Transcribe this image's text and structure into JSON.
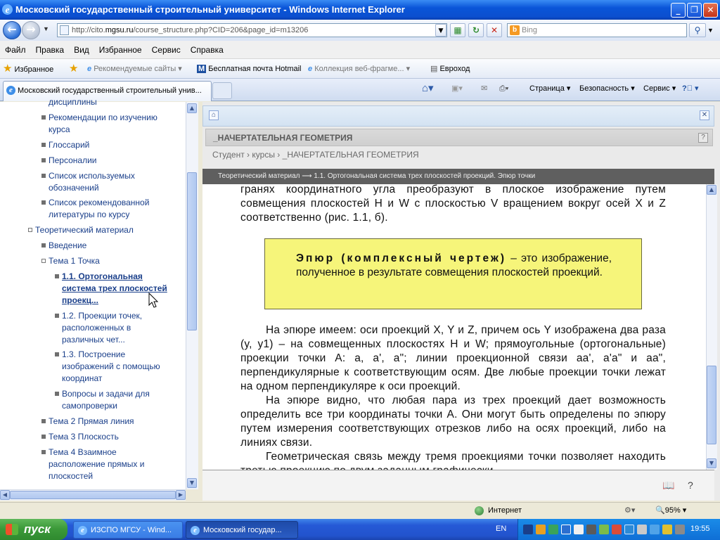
{
  "window": {
    "title": "Московский государственный строительный университет - Windows Internet Explorer"
  },
  "address": {
    "url_prefix": "http://cito.",
    "url_domain": "mgsu.ru",
    "url_rest": "/course_structure.php?CID=206&page_id=m13206",
    "search_placeholder": "Bing",
    "search_brand": "b"
  },
  "menu": [
    "Файл",
    "Правка",
    "Вид",
    "Избранное",
    "Сервис",
    "Справка"
  ],
  "favorites": {
    "favorites_label": "Избранное",
    "items": [
      "Рекомендуемые сайты",
      "Бесплатная почта Hotmail",
      "Коллекция веб-фрагме...",
      "Евроход"
    ]
  },
  "tabs": {
    "active": "Московский государственный строительный унив..."
  },
  "commandbar": {
    "page": "Страница",
    "safety": "Безопасность",
    "tools": "Сервис"
  },
  "sidebar": {
    "items": [
      {
        "label": "дисциплины"
      },
      {
        "label": "Рекомендации по изучению курса"
      },
      {
        "label": "Глоссарий"
      },
      {
        "label": "Персоналии"
      },
      {
        "label": "Список используемых обозначений"
      },
      {
        "label": "Список рекомендованной литературы по курсу"
      },
      {
        "label": "Теоретический материал"
      },
      {
        "label": "Введение"
      },
      {
        "label": "Тема 1 Точка"
      },
      {
        "label": "1.1. Ортогональная система трех плоскостей проекц..."
      },
      {
        "label": "1.2. Проекции точек, расположенных в различных чет..."
      },
      {
        "label": "1.3. Построение изображений с помощью координат"
      },
      {
        "label": "Вопросы и задачи для самопроверки"
      },
      {
        "label": "Тема 2 Прямая линия"
      },
      {
        "label": "Тема 3 Плоскость"
      },
      {
        "label": "Тема 4 Взаимное расположение прямых и плоскостей"
      }
    ]
  },
  "course": {
    "header": "_НАЧЕРТАТЕЛЬНАЯ ГЕОМЕТРИЯ",
    "breadcrumb": [
      "Студент",
      "курсы",
      "_НАЧЕРТАТЕЛЬНАЯ ГЕОМЕТРИЯ"
    ],
    "breadcrumb_sep": "›",
    "section_path": "Теоретический материал ⟶ 1.1. Ортогональная система трех плоскостей проекций. Эпюр точки"
  },
  "content": {
    "para_top": "гранях координатного угла преобразуют в плоское изображение путем совмещения плоскостей H и W с плоскостью V вращением вокруг осей X и Z соответственно (рис. 1.1, б).",
    "definition_term": "Эпюр (комплексный чертеж)",
    "definition_dash": " – ",
    "definition_text": "это изображение, полученное в результате совмещения плоскостей проекций.",
    "para_1": "На эпюре имеем: оси проекций X, Y и Z, причем ось Y изображена два раза (y, y1) – на совмещенных плоскостях H и W; прямоугольные (ортогональные) проекции точки A: a, a', a\"; линии проекционной связи aa', a'a\" и aa\", перпендикулярные к соответствующим осям. Две любые проекции точки лежат на одном перпендикуляре к оси проекций.",
    "para_2": "На эпюре видно, что любая пара из трех проекций дает возможность определить все три координаты точки A. Они могут быть определены по эпюру путем измерения соответствующих отрезков либо на осях проекций, либо на линиях связи.",
    "para_3": "Геометрическая связь между тремя проекциями точки позволяет находить третью проекцию по двум заданным графически"
  },
  "status": {
    "zone": "Интернет",
    "zoom": "95%"
  },
  "taskbar": {
    "start": "пуск",
    "tasks": [
      "ИЗСПО МГСУ - Wind...",
      "Московский государ..."
    ],
    "lang": "EN",
    "clock": "19:55"
  }
}
